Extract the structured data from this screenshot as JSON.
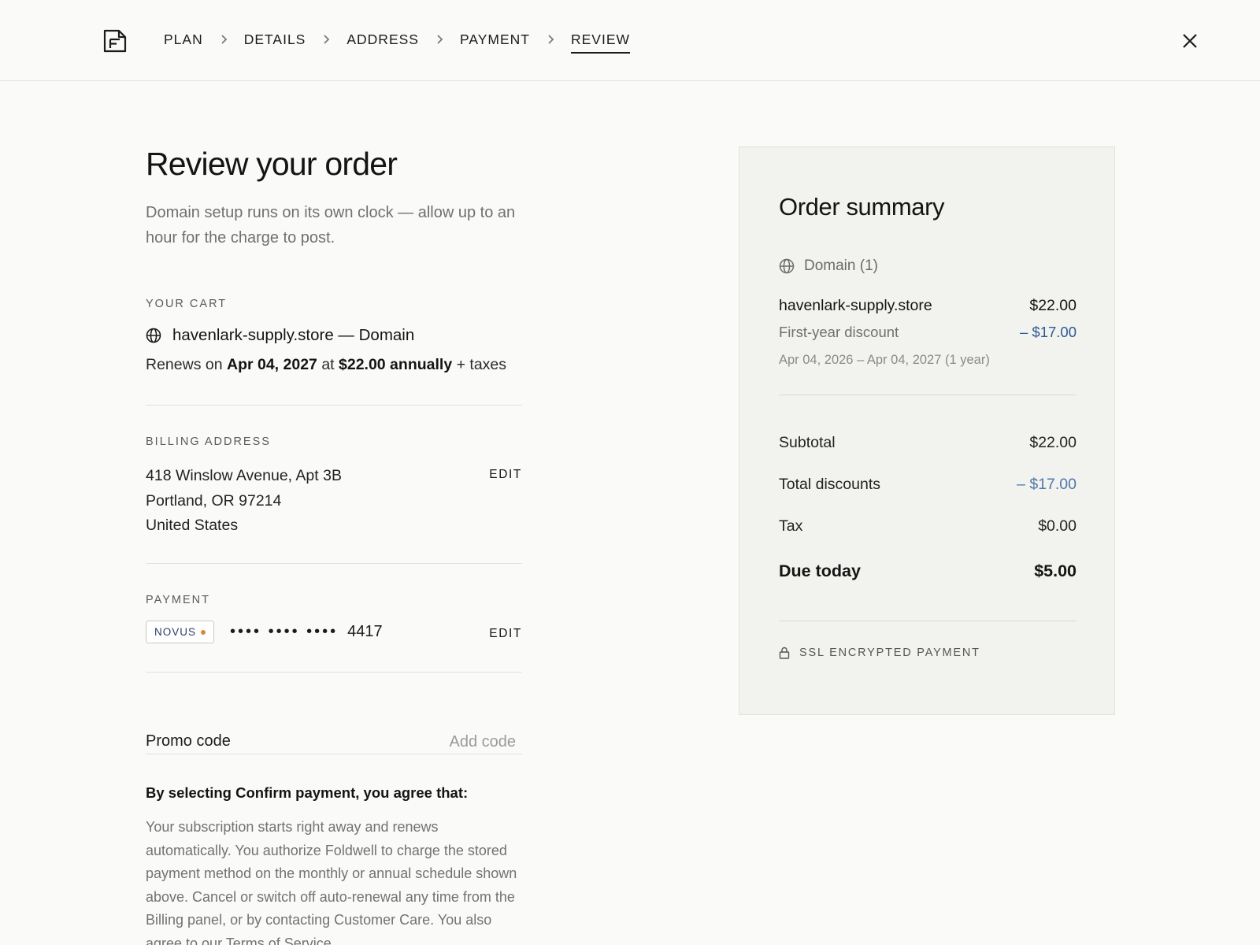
{
  "header": {
    "steps": [
      "PLAN",
      "DETAILS",
      "ADDRESS",
      "PAYMENT",
      "REVIEW"
    ],
    "active_step": "REVIEW"
  },
  "main": {
    "title": "Review your order",
    "intro": "Domain setup runs on its own clock — allow up to an hour for the charge to post.",
    "cart": {
      "label": "YOUR CART",
      "item": "havenlark-supply.store — Domain",
      "renews_prefix": "Renews on",
      "renew_date": "Apr 04, 2027",
      "renews_at": "at",
      "renew_price": "$22.00 annually",
      "renews_suffix": "+ taxes"
    },
    "billing": {
      "label": "BILLING ADDRESS",
      "line1": "418 Winslow Avenue, Apt 3B",
      "line2": "Portland, OR 97214",
      "line3": "United States",
      "edit": "EDIT"
    },
    "payment": {
      "label": "PAYMENT",
      "brand": "NOVUS",
      "masked": "•••• •••• ••••",
      "last4": "4417",
      "edit": "EDIT"
    },
    "promo": {
      "label": "Promo code",
      "placeholder": "Add code"
    },
    "terms": {
      "heading": "By selecting Confirm payment, you agree that:",
      "body": "Your subscription starts right away and renews automatically. You authorize Foldwell to charge the stored payment method on the monthly or annual schedule shown above. Cancel or switch off auto-renewal any time from the Billing panel, or by contacting Customer Care. You also agree to our Terms of Service."
    }
  },
  "summary": {
    "title": "Order summary",
    "group": "Domain (1)",
    "item_name": "havenlark-supply.store",
    "item_price": "$22.00",
    "discount_label": "First-year discount",
    "discount_value": "– $17.00",
    "dates": "Apr 04, 2026 – Apr 04, 2027 (1 year)",
    "subtotal_label": "Subtotal",
    "subtotal_value": "$22.00",
    "total_discounts_label": "Total discounts",
    "total_discounts_value": "– $17.00",
    "tax_label": "Tax",
    "tax_value": "$0.00",
    "due_label": "Due today",
    "due_value": "$5.00",
    "secure": "SSL ENCRYPTED PAYMENT"
  },
  "icons": {
    "logo": "document-logo-icon",
    "chevron": "chevron-right-icon",
    "close": "close-icon",
    "globe": "globe-icon",
    "lock": "lock-icon"
  },
  "colors": {
    "accent_discount": "#2d5a94",
    "brand_dot": "#d68a3d"
  }
}
